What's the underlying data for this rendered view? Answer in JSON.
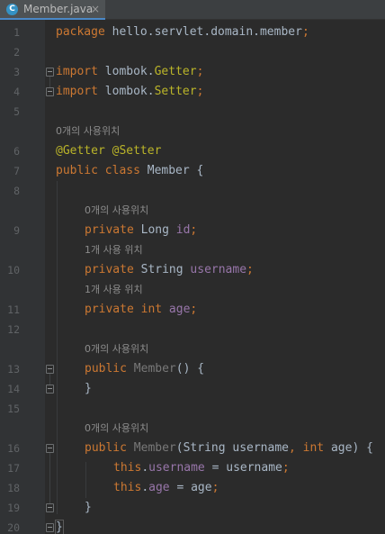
{
  "tab": {
    "icon_letter": "C",
    "title": "Member.java",
    "close": "×"
  },
  "colors": {
    "background": "#2b2b2b",
    "keyword": "#cc7832",
    "annotation": "#bbb529",
    "field": "#9876aa",
    "text": "#a9b7c6",
    "hint": "#8c8c8c"
  },
  "line_numbers": [
    "1",
    "2",
    "3",
    "4",
    "5",
    "6",
    "7",
    "8",
    "9",
    "10",
    "11",
    "12",
    "13",
    "14",
    "15",
    "16",
    "17",
    "18",
    "19",
    "20"
  ],
  "hints": {
    "h6": "0개의 사용위치",
    "h9": "0개의 사용위치",
    "h10": "1개 사용 위치",
    "h11": "1개 사용 위치",
    "h13": "0개의 사용위치",
    "h16": "0개의 사용위치"
  },
  "code": {
    "l1": {
      "kw": "package",
      "rest": " hello.servlet.domain.member",
      "semi": ";"
    },
    "l3": {
      "kw": "import",
      "pkg": " lombok.",
      "cls": "Getter",
      "semi": ";"
    },
    "l4": {
      "kw": "import",
      "pkg": " lombok.",
      "cls": "Setter",
      "semi": ";"
    },
    "l6": {
      "text": "@Getter @Setter"
    },
    "l7": {
      "kw": "public class",
      "rest": " Member {"
    },
    "l9": {
      "kw": "private",
      "type": " Long ",
      "field": "id",
      "semi": ";"
    },
    "l10": {
      "kw": "private",
      "type": " String ",
      "field": "username",
      "semi": ";"
    },
    "l11": {
      "kw": "private int",
      "type": " ",
      "field": "age",
      "semi": ";"
    },
    "l13": {
      "kw": "public",
      "name": " Member",
      "rest": "() {"
    },
    "l14": {
      "text": "}"
    },
    "l16": {
      "kw": "public",
      "name": " Member",
      "p1": "(String username",
      "comma": ",",
      "kw2": " int",
      "p2": " age) {"
    },
    "l17": {
      "kw": "this",
      "dot": ".",
      "field": "username",
      "rest": " = username",
      "semi": ";"
    },
    "l18": {
      "kw": "this",
      "dot": ".",
      "field": "age",
      "rest": " = age",
      "semi": ";"
    },
    "l19": {
      "text": "}"
    },
    "l20": {
      "text": "}"
    }
  }
}
